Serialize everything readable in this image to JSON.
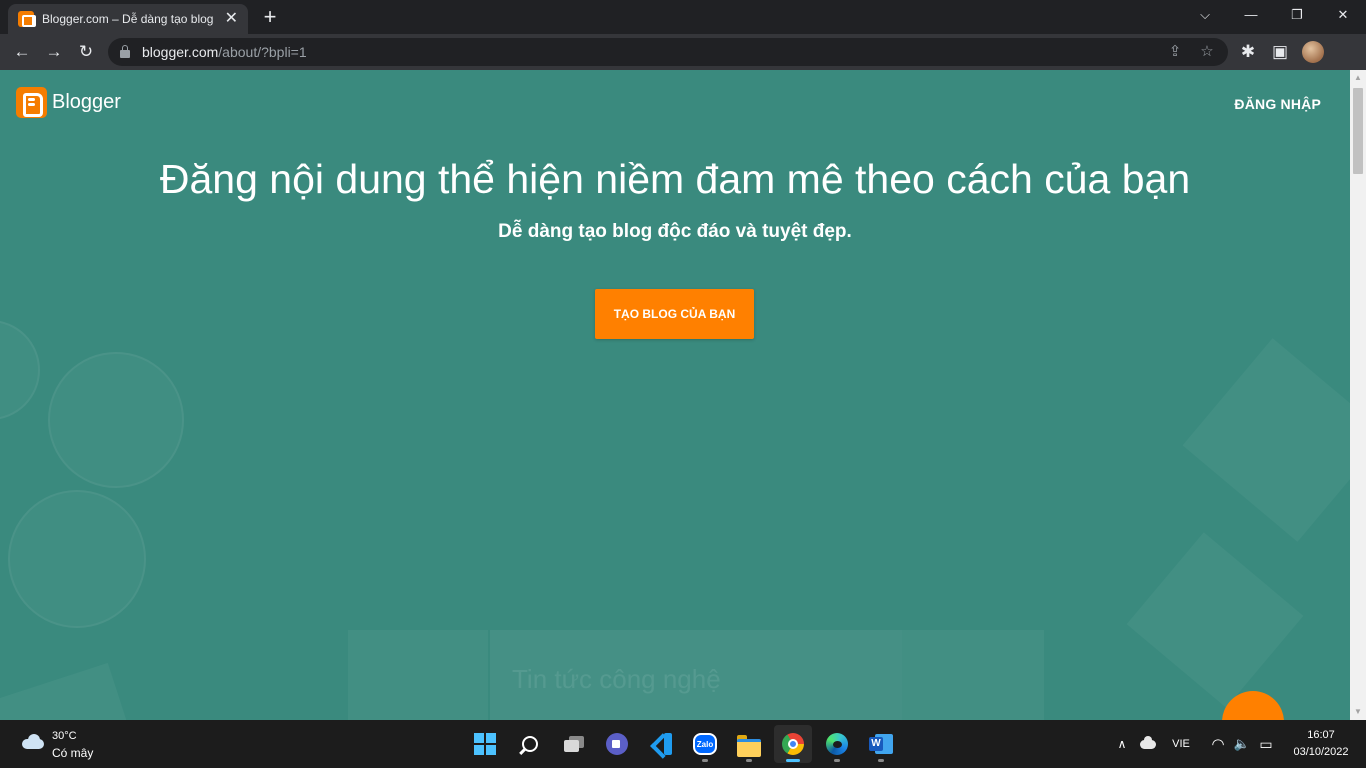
{
  "browser": {
    "tab_title": "Blogger.com – Dễ dàng tạo blog",
    "tab_close": "✕",
    "new_tab": "+",
    "window_controls": {
      "minimize": "⌵",
      "maximize": "—",
      "restore": "❐",
      "close": "✕"
    },
    "nav": {
      "back": "←",
      "forward": "→",
      "reload": "↻"
    },
    "url_host": "blogger.com",
    "url_path": "/about/?bpli=1",
    "omnibox_icons": {
      "share": "⇪",
      "bookmark": "☆"
    },
    "toolbar_icons": {
      "extensions": "✱",
      "side_panel": "▣"
    }
  },
  "page": {
    "logo_text": "Blogger",
    "signin_label": "ĐĂNG NHẬP",
    "hero_title": "Đăng nội dung thể hiện niềm đam mê theo cách của bạn",
    "hero_subtitle": "Dễ dàng tạo blog độc đáo và tuyệt đẹp.",
    "cta_label": "TẠO BLOG CỦA BẠN",
    "background_preview_text": "Tin tức công nghệ",
    "colors": {
      "background": "#3a8a7e",
      "accent": "#ff8000"
    }
  },
  "scrollbar": {
    "up": "▲",
    "down": "▼"
  },
  "taskbar": {
    "weather_temp": "30°C",
    "weather_condition": "Có mây",
    "apps": [
      "start",
      "search",
      "task-view",
      "meet-now",
      "vscode",
      "zalo",
      "file-explorer",
      "chrome",
      "edge",
      "word"
    ],
    "zalo_label": "Zalo",
    "tray_chevron": "∧",
    "language": "VIE",
    "wifi": "◠",
    "volume": "🔈",
    "battery": "▭",
    "time": "16:07",
    "date": "03/10/2022"
  }
}
